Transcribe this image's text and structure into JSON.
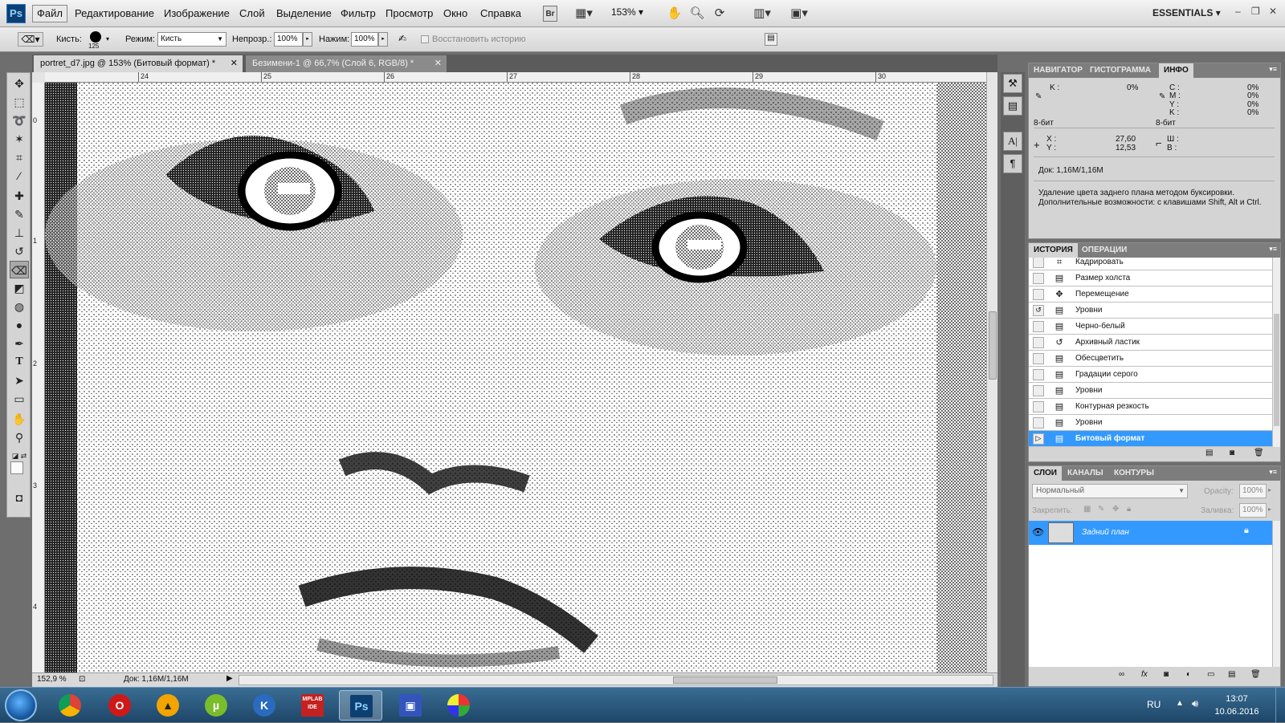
{
  "menubar": {
    "logo": "Ps",
    "items": [
      "Файл",
      "Редактирование",
      "Изображение",
      "Слой",
      "Выделение",
      "Фильтр",
      "Просмотр",
      "Окно",
      "Справка"
    ],
    "bridge_label": "Br",
    "zoom": "153%",
    "workspace": "ESSENTIALS"
  },
  "options": {
    "brush_label": "Кисть:",
    "brush_size": "125",
    "mode_label": "Режим:",
    "mode_value": "Кисть",
    "opacity_label": "Непрозр.:",
    "opacity_value": "100%",
    "flow_label": "Нажим:",
    "flow_value": "100%",
    "restore_history": "Восстановить историю"
  },
  "tabs": [
    {
      "label": "portret_d7.jpg @ 153% (Битовый формат) *"
    },
    {
      "label": "Безимени-1 @ 66,7% (Слой 6, RGB/8) *"
    }
  ],
  "ruler": {
    "top": [
      "24",
      "25",
      "26",
      "27",
      "28",
      "29",
      "30"
    ],
    "left": [
      "0",
      "1",
      "1",
      "2",
      "3",
      "4"
    ]
  },
  "status": {
    "zoom": "152,9 %",
    "doc": "Док: 1,16M/1,16M"
  },
  "info_panel": {
    "tabs": [
      "НАВИГАТОР",
      "ГИСТОГРАММА",
      "ИНФО"
    ],
    "k_label": "K :",
    "k_value": "0%",
    "c_label": "C :",
    "c_value": "0%",
    "m_label": "M :",
    "m_value": "0%",
    "y_label": "Y :",
    "y_value": "0%",
    "k2_label": "K :",
    "k2_value": "0%",
    "bit_left": "8-бит",
    "bit_right": "8-бит",
    "x_label": "X :",
    "x_value": "27,60",
    "y2_label": "Y :",
    "y2_value": "12,53",
    "w_label": "Ш :",
    "h_label": "В :",
    "doc": "Док: 1,16M/1,16M",
    "hint": "Удаление цвета заднего плана методом буксировки. Дополнительные возможности: с клавишами Shift, Alt и Ctrl."
  },
  "history_panel": {
    "tabs": [
      "ИСТОРИЯ",
      "ОПЕРАЦИИ"
    ],
    "items": [
      {
        "label": "Кадрировать",
        "icon": "crop-icon"
      },
      {
        "label": "Размер холста",
        "icon": "document-icon"
      },
      {
        "label": "Перемещение",
        "icon": "move-icon"
      },
      {
        "label": "Уровни",
        "icon": "document-icon"
      },
      {
        "label": "Черно-белый",
        "icon": "document-icon"
      },
      {
        "label": "Архивный ластик",
        "icon": "history-brush-icon"
      },
      {
        "label": "Обесцветить",
        "icon": "document-icon"
      },
      {
        "label": "Градации серого",
        "icon": "document-icon"
      },
      {
        "label": "Уровни",
        "icon": "document-icon"
      },
      {
        "label": "Контурная резкость",
        "icon": "document-icon"
      },
      {
        "label": "Уровни",
        "icon": "document-icon"
      },
      {
        "label": "Битовый формат",
        "icon": "document-icon",
        "selected": true
      }
    ]
  },
  "layers_panel": {
    "tabs": [
      "СЛОИ",
      "КАНАЛЫ",
      "КОНТУРЫ"
    ],
    "blend_mode": "Нормальный",
    "opacity_label": "Opacity:",
    "opacity_value": "100%",
    "lock_label": "Закрепить:",
    "fill_label": "Заливка:",
    "fill_value": "100%",
    "layer_name": "Задний план"
  },
  "taskbar": {
    "lang": "RU",
    "time": "13:07",
    "date": "10.06.2016",
    "apps": [
      "chrome-icon",
      "opera-icon",
      "aimp-icon",
      "utorrent-icon",
      "browser-icon",
      "mplab-icon",
      "photoshop-icon",
      "save-icon",
      "disk-icon"
    ],
    "ps_label": "Ps",
    "mplab_label": "MPLAB IDE"
  },
  "colors": {
    "selection": "#3399ff",
    "panel_bg": "#d4d4d4",
    "taskbar": "#2b5678"
  }
}
